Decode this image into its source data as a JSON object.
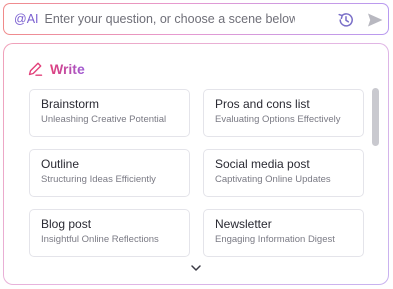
{
  "ai_bar": {
    "prefix": "@AI",
    "placeholder": "Enter your question, or choose a scene below"
  },
  "write_panel": {
    "title": "Write",
    "cards": [
      {
        "title": "Brainstorm",
        "subtitle": "Unleashing Creative Potential"
      },
      {
        "title": "Pros and cons list",
        "subtitle": "Evaluating Options Effectively"
      },
      {
        "title": "Outline",
        "subtitle": "Structuring Ideas Efficiently"
      },
      {
        "title": "Social media post",
        "subtitle": "Captivating Online Updates"
      },
      {
        "title": "Blog post",
        "subtitle": "Insightful Online Reflections"
      },
      {
        "title": "Newsletter",
        "subtitle": "Engaging Information Digest"
      }
    ]
  },
  "colors": {
    "accent_pink": "#e2407a",
    "accent_purple": "#9d5ad6",
    "icon_purple": "#7a5fd0"
  },
  "icons": [
    "history-icon",
    "send-icon",
    "pen-icon",
    "chevron-down-icon"
  ]
}
